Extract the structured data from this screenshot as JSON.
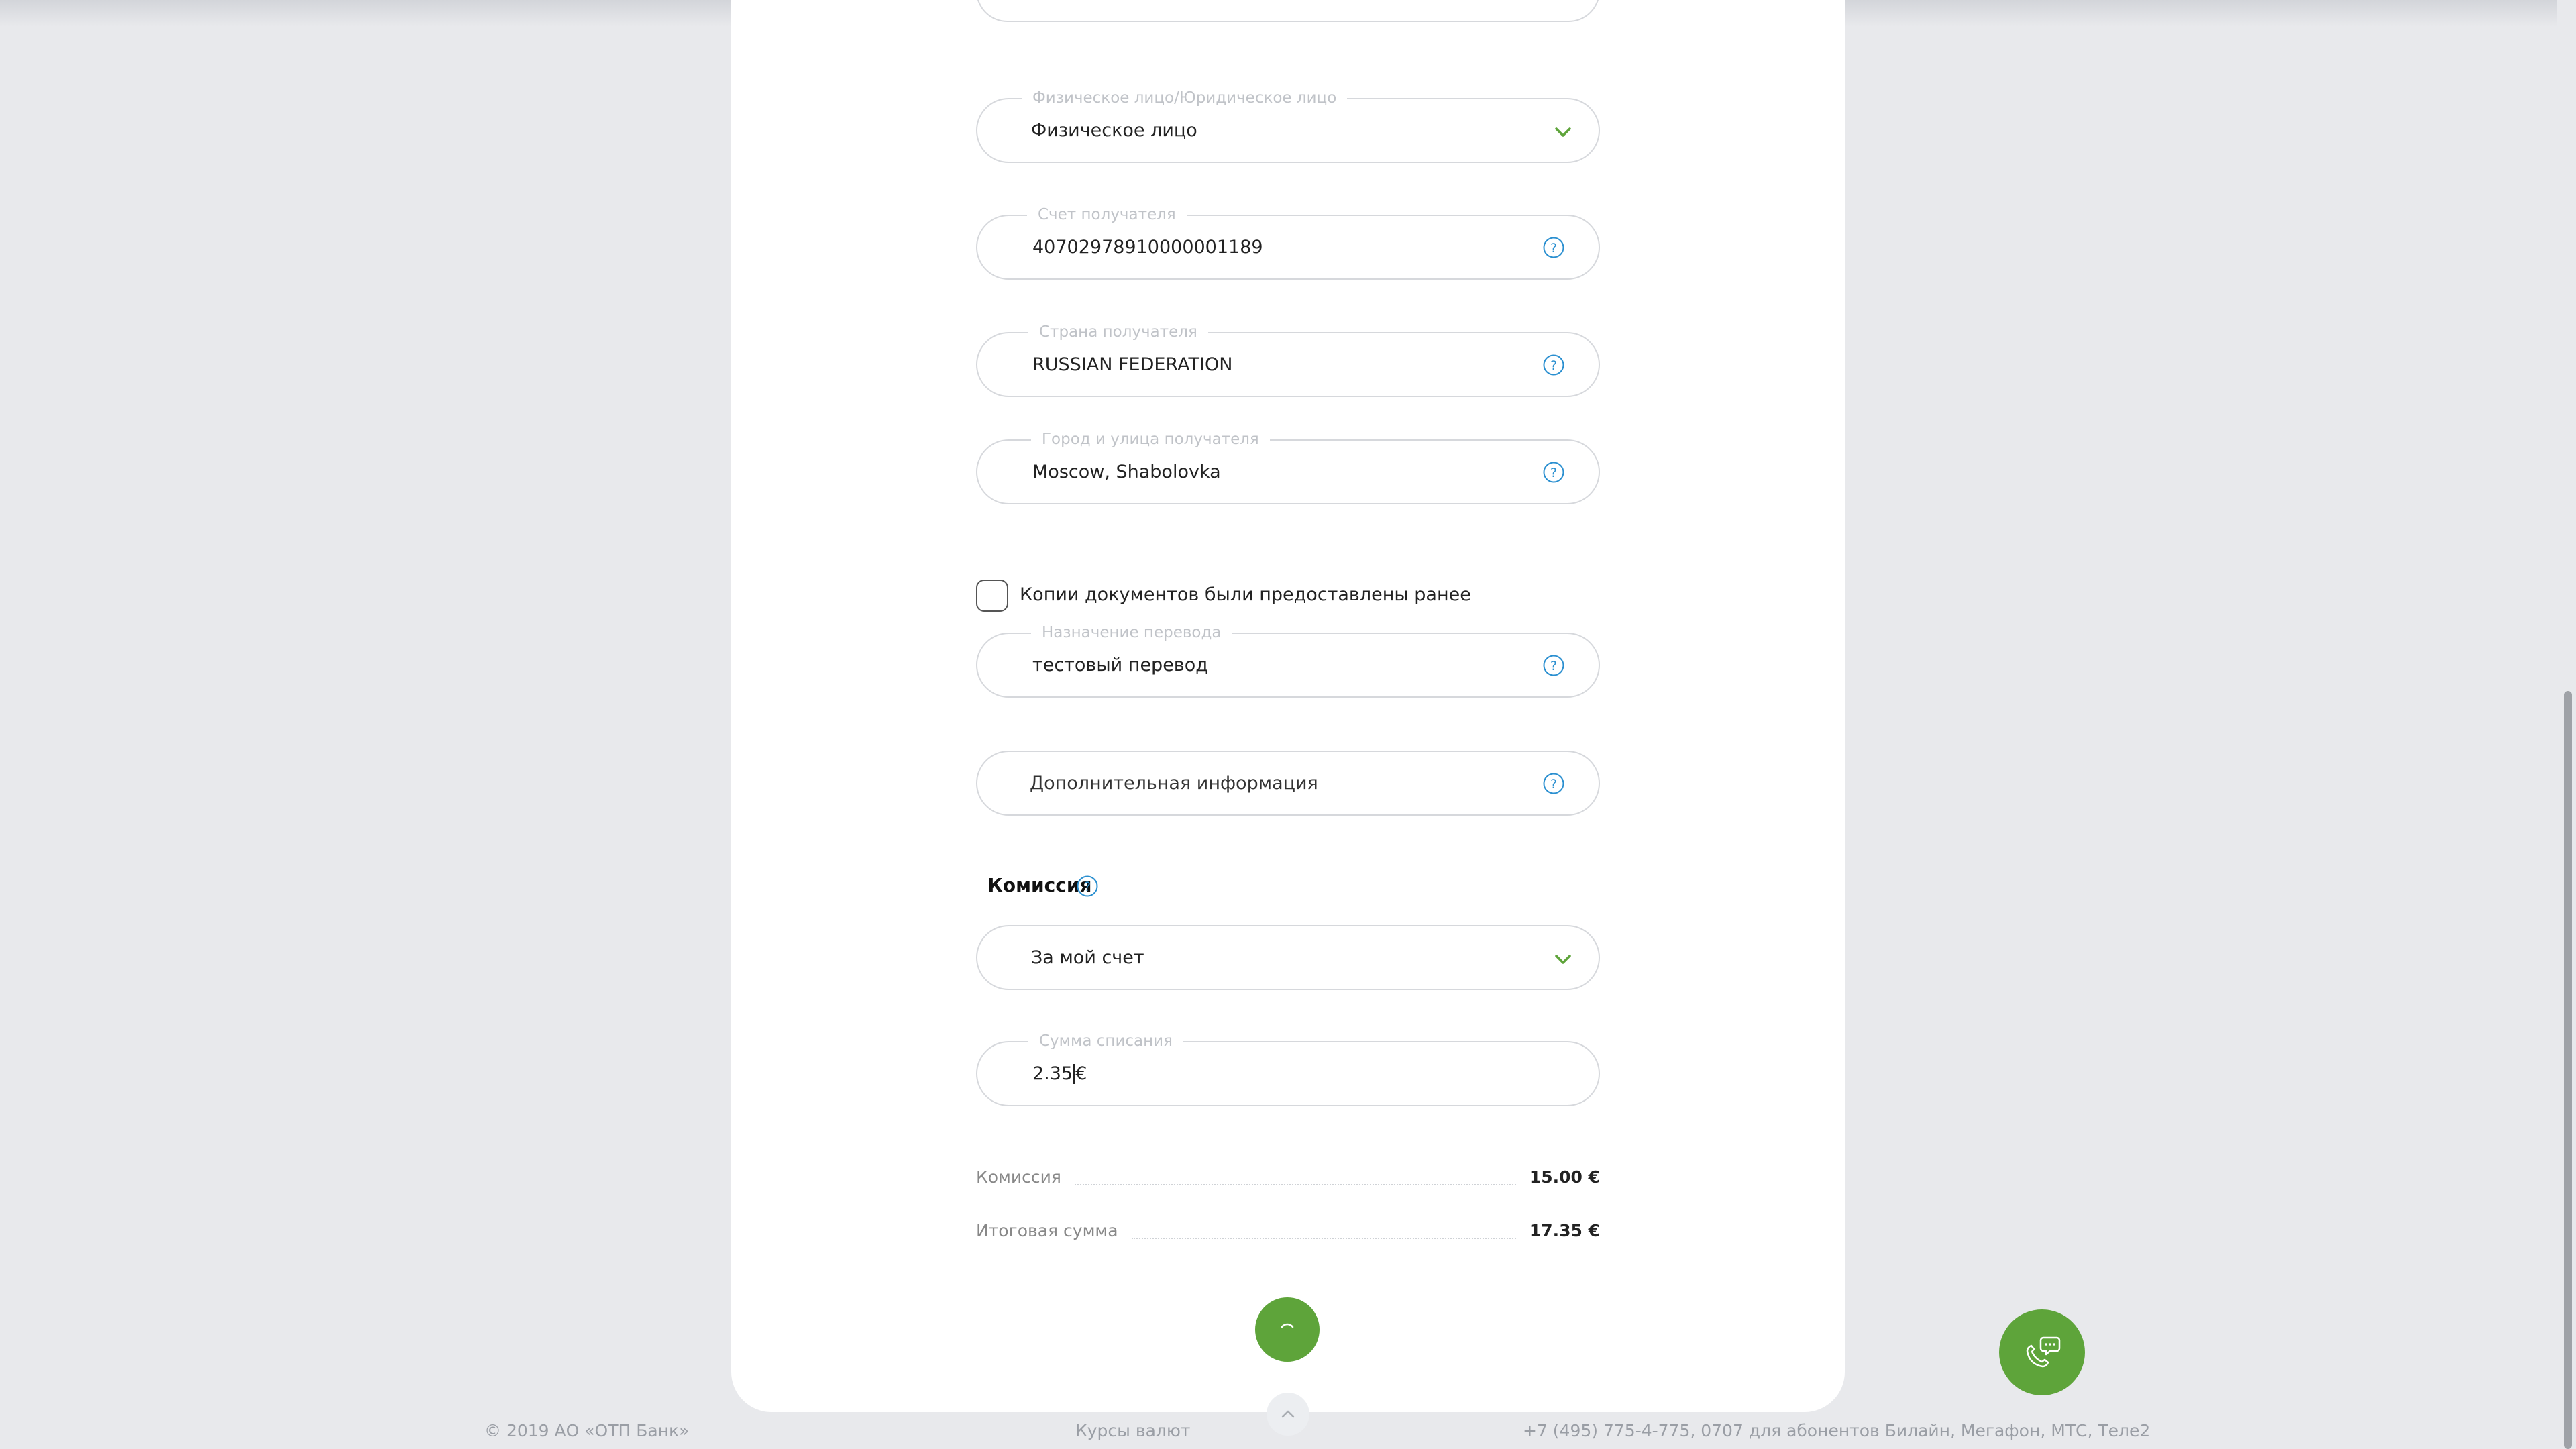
{
  "form": {
    "entity_type": {
      "label": "Физическое лицо/Юридическое лицо",
      "value": "Физическое лицо"
    },
    "account": {
      "label": "Счет получателя",
      "value": "40702978910000001189"
    },
    "country": {
      "label": "Страна получателя",
      "value": "RUSSIAN FEDERATION"
    },
    "address": {
      "label": "Город и улица получателя",
      "value": "Moscow, Shabolovka"
    },
    "docs_checkbox": {
      "label": "Копии документов были предоставлены ранее",
      "checked": false
    },
    "purpose": {
      "label": "Назначение перевода",
      "value": "тестовый перевод"
    },
    "additional_info": {
      "placeholder": "Дополнительная информация"
    },
    "commission_section": {
      "title": "Комиссия"
    },
    "commission_payer": {
      "value": "За мой счет"
    },
    "debit_amount": {
      "label": "Сумма списания",
      "value": "2.35",
      "currency": "€"
    }
  },
  "summary": {
    "commission_label": "Комиссия",
    "commission_value": "15.00 €",
    "total_label": "Итоговая сумма",
    "total_value": "17.35 €"
  },
  "footer": {
    "copyright": "© 2019 АО «ОТП Банк»",
    "rates_link": "Курсы валют",
    "phones": "+7 (495) 775-4-775,   0707 для абонентов Билайн, Мегафон, МТС, Теле2"
  },
  "colors": {
    "accent_green": "#5ea43a",
    "help_blue": "#2a8fd0"
  },
  "icons": {
    "submit": "loading-spinner-icon",
    "chat": "phone-chat-icon",
    "help": "question-icon",
    "dropdown": "chevron-down-icon",
    "scroll_up": "chevron-up-icon"
  }
}
